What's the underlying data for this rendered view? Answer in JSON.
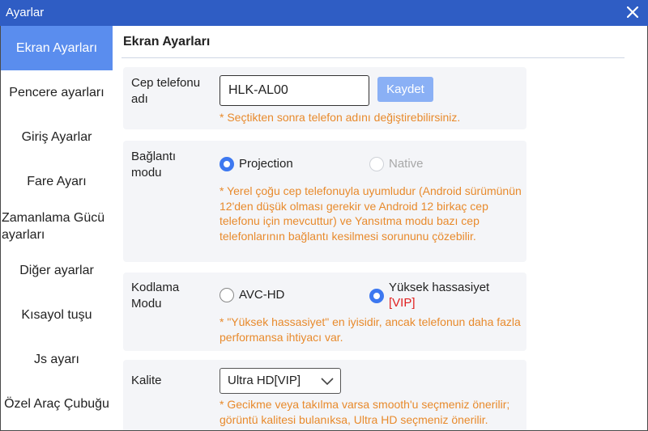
{
  "window": {
    "title": "Ayarlar",
    "close_icon": "close-icon"
  },
  "sidebar": {
    "items": [
      {
        "label": "Ekran Ayarları",
        "active": true
      },
      {
        "label": "Pencere ayarları"
      },
      {
        "label": "Giriş Ayarlar"
      },
      {
        "label": "Fare Ayarı"
      },
      {
        "label": "Zamanlama Gücü ayarları"
      },
      {
        "label": "Diğer ayarlar"
      },
      {
        "label": "Kısayol tuşu"
      },
      {
        "label": "Js ayarı"
      },
      {
        "label": "Özel Araç Çubuğu"
      }
    ]
  },
  "main": {
    "title": "Ekran Ayarları",
    "phone_name": {
      "label": "Cep telefonu adı",
      "value": "HLK-AL00",
      "save_label": "Kaydet",
      "hint": "* Seçtikten sonra telefon adını değiştirebilirsiniz."
    },
    "connection": {
      "label": "Bağlantı modu",
      "options": [
        {
          "label": "Projection",
          "selected": true
        },
        {
          "label": "Native",
          "disabled": true
        }
      ],
      "hint": "* Yerel çoğu cep telefonuyla uyumludur (Android sürümünün 12'den düşük olması gerekir ve Android 12 birkaç cep telefonu için mevcuttur) ve Yansıtma modu bazı cep telefonlarının bağlantı kesilmesi sorununu çözebilir."
    },
    "encoding": {
      "label": "Kodlama Modu",
      "options": [
        {
          "label": "AVC-HD",
          "selected": false
        },
        {
          "label": "Yüksek hassasiyet",
          "tag": "[VIP]",
          "selected": true
        }
      ],
      "hint": "* \"Yüksek hassasiyet\" en iyisidir, ancak telefonun daha fazla performansa ihtiyacı var."
    },
    "quality": {
      "label": "Kalite",
      "selected": "Ultra HD[VIP]",
      "hint": "* Gecikme veya takılma varsa smooth'u seçmeniz önerilir; görüntü kalitesi bulanıksa, Ultra HD seçmeniz önerilir."
    }
  },
  "colors": {
    "titlebar": "#2f5dc4",
    "accent": "#5a8dee",
    "hint": "#e88a2c",
    "vip": "#e02020"
  }
}
